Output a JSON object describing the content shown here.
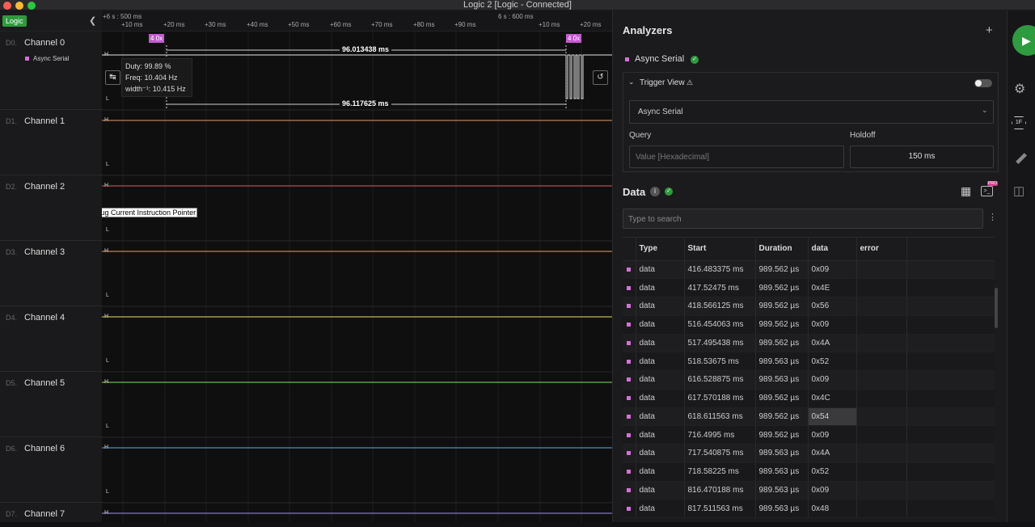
{
  "window": {
    "title": "Logic 2 [Logic - Connected]"
  },
  "toolbar": {
    "logic_tab": "Logic"
  },
  "ruler": {
    "left_label": "+6 s : 500 ms",
    "right_label": "6 s : 600 ms",
    "ticks": [
      "+10 ms",
      "+20 ms",
      "+30 ms",
      "+40 ms",
      "+50 ms",
      "+60 ms",
      "+70 ms",
      "+80 ms",
      "+90 ms",
      "+10 ms",
      "+20 ms"
    ]
  },
  "channels": [
    {
      "id": "D0.",
      "name": "Channel 0",
      "analyzer": "Async Serial"
    },
    {
      "id": "D1.",
      "name": "Channel 1"
    },
    {
      "id": "D2.",
      "name": "Channel 2"
    },
    {
      "id": "D3.",
      "name": "Channel 3"
    },
    {
      "id": "D4.",
      "name": "Channel 4"
    },
    {
      "id": "D5.",
      "name": "Channel 5"
    },
    {
      "id": "D6.",
      "name": "Channel 6"
    },
    {
      "id": "D7.",
      "name": "Channel 7"
    }
  ],
  "lane_colors": [
    "#ffffff",
    "#e89a62",
    "#e05a5a",
    "#e8a060",
    "#e8e060",
    "#88e060",
    "#60a8e8",
    "#a090e8"
  ],
  "waveform": {
    "h_label": "H",
    "l_label": "L",
    "marker_left": "4 0x",
    "marker_right": "4 0x",
    "measure_top": "96.013438 ms",
    "measure_bottom": "96.117625 ms",
    "tooltip": {
      "duty": "Duty: 99.89 %",
      "freq": "Freq: 10.404 Hz",
      "width": "width⁻¹: 10.415 Hz"
    },
    "annotation": "Debug Current Instruction Pointer"
  },
  "analyzers": {
    "heading": "Analyzers",
    "add_icon": "+",
    "item": "Async Serial",
    "trigger_view": "Trigger View",
    "trigger_select": "Async Serial",
    "query_label": "Query",
    "query_placeholder": "Value [Hexadecimal]",
    "holdoff_label": "Holdoff",
    "holdoff_value": "150 ms"
  },
  "data_panel": {
    "heading": "Data",
    "search_placeholder": "Type to search",
    "pro_badge": "PRO",
    "columns": [
      "Type",
      "Start",
      "Duration",
      "data",
      "error"
    ],
    "rows": [
      {
        "type": "data",
        "start": "416.483375 ms",
        "duration": "989.562 µs",
        "data": "0x09",
        "error": ""
      },
      {
        "type": "data",
        "start": "417.52475 ms",
        "duration": "989.562 µs",
        "data": "0x4E",
        "error": ""
      },
      {
        "type": "data",
        "start": "418.566125 ms",
        "duration": "989.562 µs",
        "data": "0x56",
        "error": ""
      },
      {
        "type": "data",
        "start": "516.454063 ms",
        "duration": "989.562 µs",
        "data": "0x09",
        "error": ""
      },
      {
        "type": "data",
        "start": "517.495438 ms",
        "duration": "989.562 µs",
        "data": "0x4A",
        "error": ""
      },
      {
        "type": "data",
        "start": "518.53675 ms",
        "duration": "989.563 µs",
        "data": "0x52",
        "error": ""
      },
      {
        "type": "data",
        "start": "616.528875 ms",
        "duration": "989.563 µs",
        "data": "0x09",
        "error": ""
      },
      {
        "type": "data",
        "start": "617.570188 ms",
        "duration": "989.562 µs",
        "data": "0x4C",
        "error": ""
      },
      {
        "type": "data",
        "start": "618.611563 ms",
        "duration": "989.562 µs",
        "data": "0x54",
        "error": ""
      },
      {
        "type": "data",
        "start": "716.4995 ms",
        "duration": "989.562 µs",
        "data": "0x09",
        "error": ""
      },
      {
        "type": "data",
        "start": "717.540875 ms",
        "duration": "989.563 µs",
        "data": "0x4A",
        "error": ""
      },
      {
        "type": "data",
        "start": "718.58225 ms",
        "duration": "989.563 µs",
        "data": "0x52",
        "error": ""
      },
      {
        "type": "data",
        "start": "816.470188 ms",
        "duration": "989.563 µs",
        "data": "0x09",
        "error": ""
      },
      {
        "type": "data",
        "start": "817.511563 ms",
        "duration": "989.563 µs",
        "data": "0x48",
        "error": ""
      }
    ]
  },
  "sidebar": {
    "icons": [
      "play-icon",
      "sliders-icon",
      "1f-hex-icon",
      "ruler-icon",
      "extensions-icon"
    ]
  },
  "colors": {
    "accent": "#2e9b3e",
    "analyzer": "#d86fd8"
  }
}
